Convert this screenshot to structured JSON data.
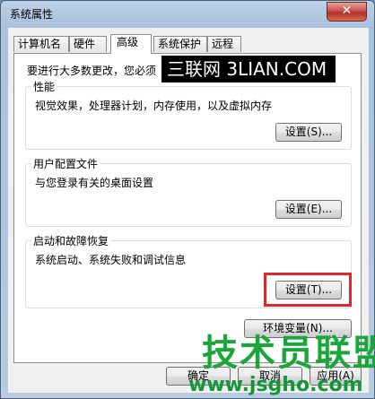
{
  "window": {
    "title": "系统属性",
    "close_glyph": "✕"
  },
  "tabs": [
    {
      "label": "计算机名"
    },
    {
      "label": "硬件"
    },
    {
      "label": "高级"
    },
    {
      "label": "系统保护"
    },
    {
      "label": "远程"
    }
  ],
  "active_tab": "高级",
  "panel": {
    "intro": "要进行大多数更改，您必须",
    "groups": [
      {
        "label": "性能",
        "desc": "视觉效果，处理器计划，内存使用，以及虚拟内存",
        "button": "设置(S)..."
      },
      {
        "label": "用户配置文件",
        "desc": "与您登录有关的桌面设置",
        "button": "设置(E)..."
      },
      {
        "label": "启动和故障恢复",
        "desc": "系统启动、系统失败和调试信息",
        "button": "设置(T)..."
      }
    ],
    "env_button": "环境变量(N)..."
  },
  "footer": {
    "ok": "确定",
    "cancel": "取消",
    "apply": "应用(A)"
  },
  "watermarks": {
    "top": "三联网 3LIAN.COM",
    "logo": "技术员联盟",
    "url": "www.jsgho.com"
  },
  "colors": {
    "highlight": "#e0262a",
    "logo": "#1aa63a"
  }
}
